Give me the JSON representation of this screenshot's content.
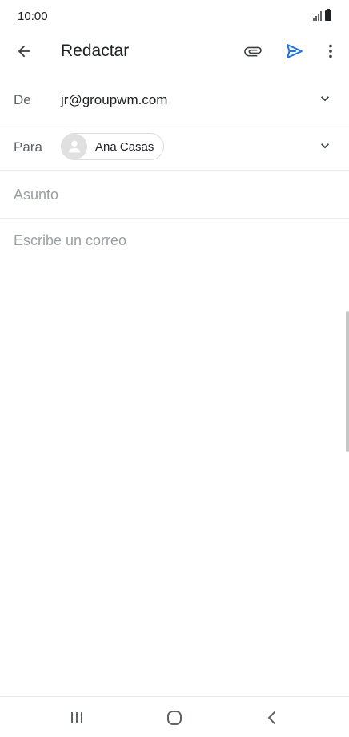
{
  "status_bar": {
    "time": "10:00",
    "signal_icon": "signal-icon",
    "battery_icon": "battery-icon"
  },
  "app_bar": {
    "title": "Redactar",
    "back_icon": "arrow-back-icon",
    "attach_icon": "paperclip-icon",
    "send_icon": "send-icon",
    "more_icon": "more-vert-icon",
    "accent_color": "#1a73e8"
  },
  "compose": {
    "from": {
      "label": "De",
      "value": "jr@groupwm.com"
    },
    "to": {
      "label": "Para",
      "recipient": "Ana Casas"
    },
    "subject": {
      "placeholder": "Asunto"
    },
    "body": {
      "placeholder": "Escribe un correo"
    }
  },
  "nav_bar": {
    "recent_icon": "recent-apps-icon",
    "home_icon": "home-icon",
    "back_icon": "nav-back-icon"
  }
}
